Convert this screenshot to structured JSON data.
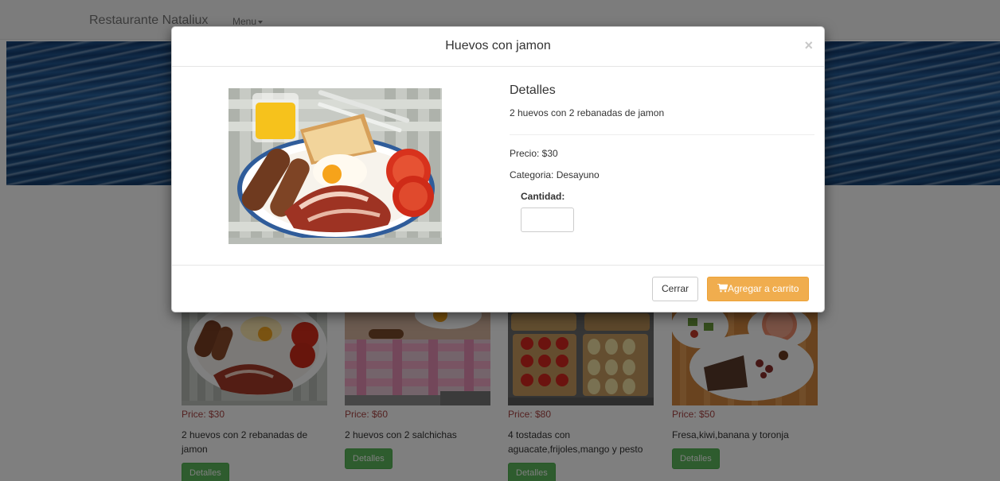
{
  "navbar": {
    "brand": "Restaurante Nataliux",
    "menu_label": "Menu"
  },
  "products": [
    {
      "price": "Price: $30",
      "description": "2 huevos con 2 rebanadas de jamon",
      "button": "Detalles"
    },
    {
      "price": "Price: $60",
      "description": "2 huevos con 2 salchichas",
      "button": "Detalles"
    },
    {
      "price": "Price: $80",
      "description": "4 tostadas con aguacate,frijoles,mango y pesto",
      "button": "Detalles"
    },
    {
      "price": "Price: $50",
      "description": "Fresa,kiwi,banana y toronja",
      "button": "Detalles"
    }
  ],
  "modal": {
    "title": "Huevos con jamon",
    "close_symbol": "×",
    "details_heading": "Detalles",
    "details_text": "2 huevos con 2 rebanadas de jamon",
    "price": "Precio: $30",
    "category": "Categoria: Desayuno",
    "quantity_label": "Cantidad:",
    "quantity_value": "",
    "cancel_label": "Cerrar",
    "add_label": "Agregar a carrito"
  },
  "colors": {
    "accent_warning": "#f0ad4e",
    "success": "#5cb85c",
    "price_red": "#a94442"
  },
  "icons": {
    "cart": "shopping-cart-icon",
    "close": "close-icon",
    "menu_caret": "caret-down-icon"
  }
}
